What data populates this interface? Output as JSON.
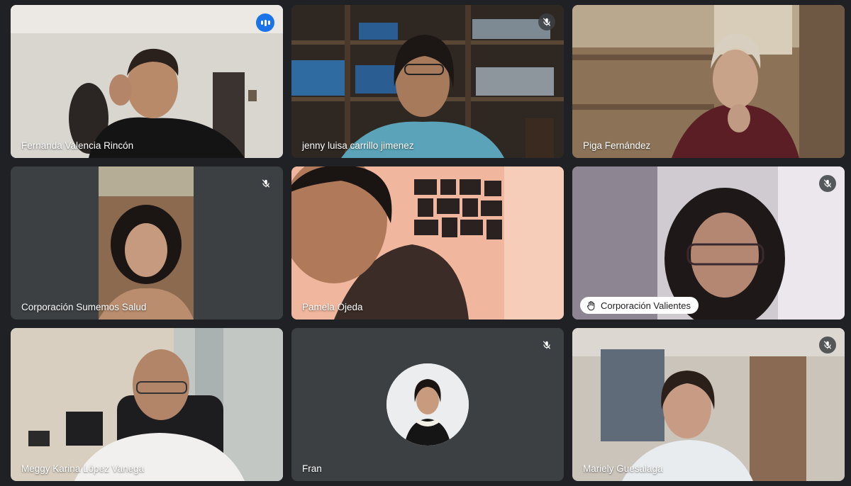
{
  "participants": [
    {
      "name": "Fernanda Valencia Rincón",
      "status": "speaking"
    },
    {
      "name": "jenny luisa carrillo jimenez",
      "status": "muted"
    },
    {
      "name": "Piga Fernández",
      "status": ""
    },
    {
      "name": "Corporación Sumemos Salud",
      "status": "muted"
    },
    {
      "name": "Pamela Ojeda",
      "status": ""
    },
    {
      "name": "Corporación Valientes",
      "status": "muted",
      "raised_hand": true
    },
    {
      "name": "Meggy Karina López Vanega",
      "status": ""
    },
    {
      "name": "Fran",
      "status": "muted"
    },
    {
      "name": "Mariely Guesalaga",
      "status": "muted"
    }
  ],
  "icons": {
    "muted": "mic-off-icon",
    "speaking": "audio-level-icon",
    "hand": "raised-hand-icon"
  },
  "colors": {
    "background": "#202124",
    "tile": "#3c4043",
    "active_border": "#8ab4f8",
    "speaking_badge": "#1a73e8"
  }
}
